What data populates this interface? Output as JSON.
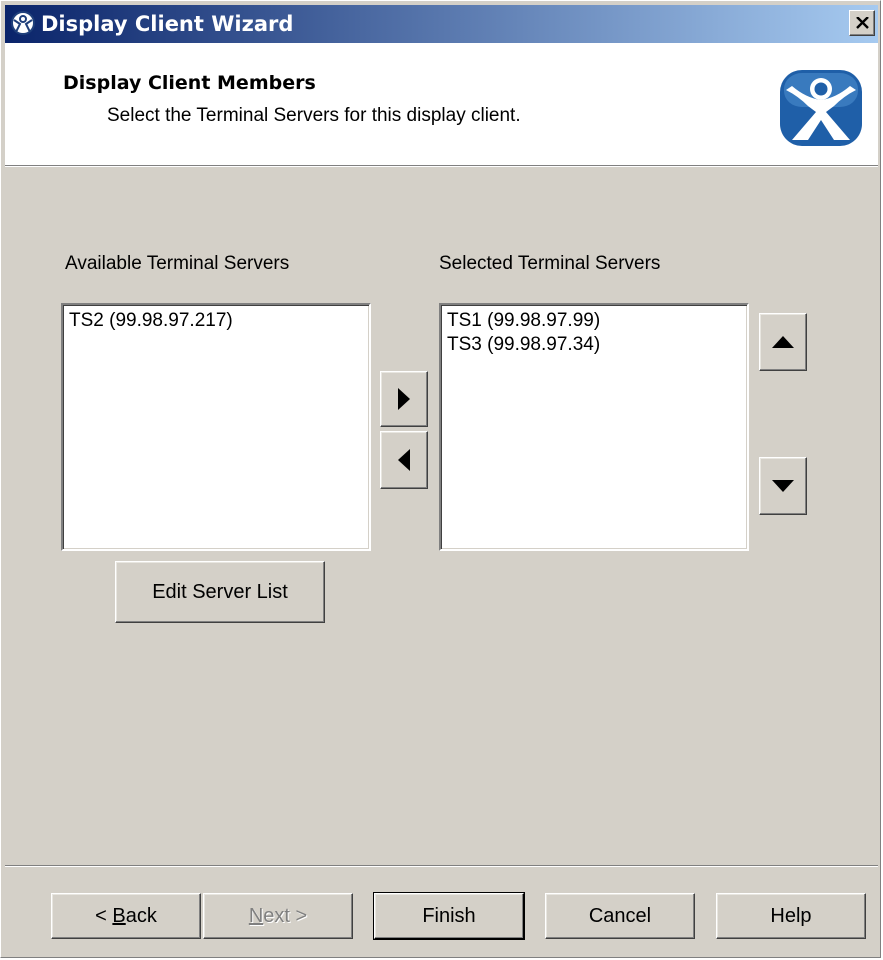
{
  "window": {
    "title": "Display Client Wizard",
    "icon": "thinmanager-icon",
    "close_label": "close-icon"
  },
  "header": {
    "title": "Display Client Members",
    "subtitle": "Select the Terminal Servers for this display client.",
    "logo": "thinmanager-logo-icon",
    "logo_color": "#1f5fa8"
  },
  "available": {
    "label": "Available Terminal Servers",
    "items": [
      "TS2 (99.98.97.217)"
    ]
  },
  "selected": {
    "label": "Selected Terminal Servers",
    "items": [
      "TS1 (99.98.97.99)",
      "TS3 (99.98.97.34)"
    ]
  },
  "controls": {
    "add_icon": "arrow-right-icon",
    "remove_icon": "arrow-left-icon",
    "move_up_icon": "arrow-up-icon",
    "move_down_icon": "arrow-down-icon",
    "edit_server_list": "Edit Server List"
  },
  "footer": {
    "back_prefix": "< ",
    "back_hotkey": "B",
    "back_rest": "ack",
    "next_hotkey": "N",
    "next_rest": "ext >",
    "finish": "Finish",
    "cancel": "Cancel",
    "help": "Help"
  },
  "colors": {
    "titlebar_start": "#0a246a",
    "titlebar_end": "#a6caf0",
    "face": "#d4d0c8"
  }
}
